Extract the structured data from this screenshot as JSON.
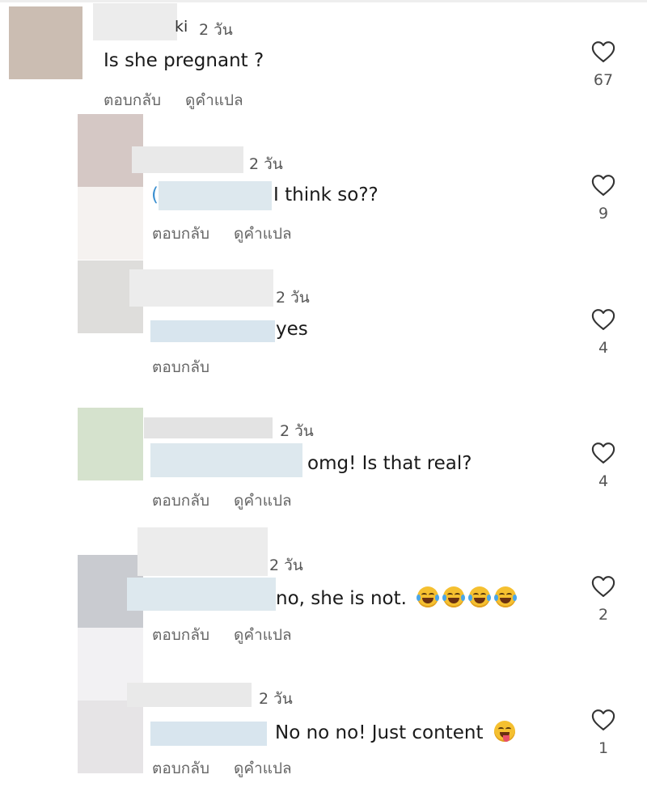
{
  "heart_icon": "heart-outline-icon",
  "colors": {
    "text": "#1a1a1a",
    "muted": "#666666",
    "mention": "#3a8fd0",
    "emoji_face": "#f5c030"
  },
  "comments": [
    {
      "name_suffix": "ki",
      "time": "2 วัน",
      "text": "Is she pregnant ?",
      "reply": "ตอบกลับ",
      "translate": "ดูคำแปล",
      "likes": "67"
    },
    {
      "paren": "(",
      "time": "2 วัน",
      "text": "I think so??",
      "reply": "ตอบกลับ",
      "translate": "ดูคำแปล",
      "likes": "9"
    },
    {
      "time": "2 วัน",
      "text": "yes",
      "reply": "ตอบกลับ",
      "likes": "4"
    },
    {
      "time": "2 วัน",
      "text": "omg! Is that real?",
      "reply": "ตอบกลับ",
      "translate": "ดูคำแปล",
      "likes": "4"
    },
    {
      "time": "2 วัน",
      "text": "no, she is not.",
      "reply": "ตอบกลับ",
      "translate": "ดูคำแปล",
      "likes": "2"
    },
    {
      "time": "2 วัน",
      "text": "No no no! Just content",
      "reply": "ตอบกลับ",
      "translate": "ดูคำแปล",
      "likes": "1"
    }
  ]
}
